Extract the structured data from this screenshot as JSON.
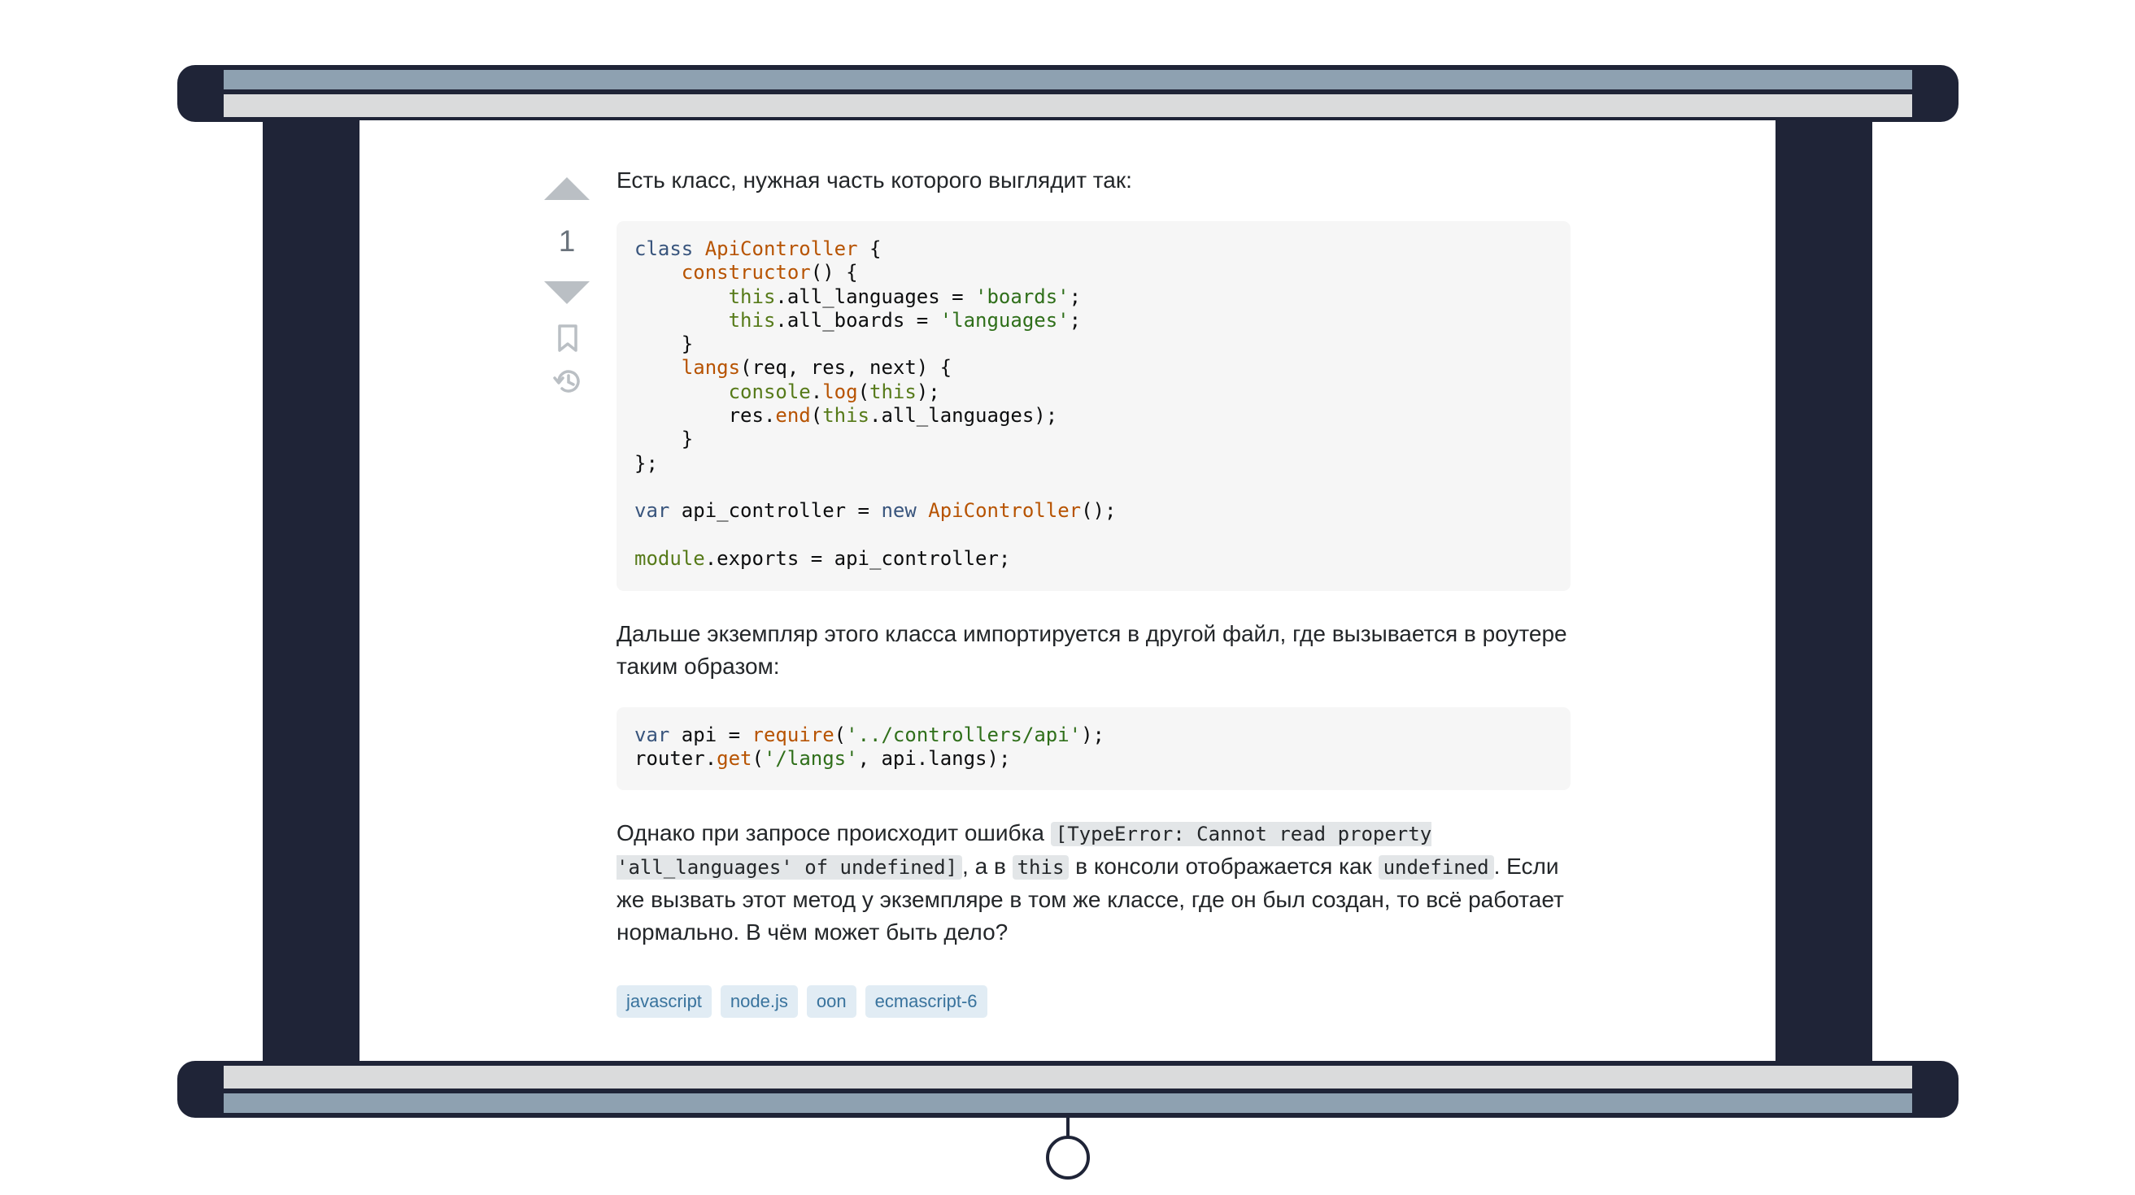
{
  "vote": {
    "count": "1",
    "upvote_icon": "triangle-up-icon",
    "downvote_icon": "triangle-down-icon",
    "bookmark_icon": "bookmark-icon",
    "history_icon": "history-icon"
  },
  "post": {
    "intro": "Есть класс, нужная часть которого выглядит так:",
    "middle": "Дальше экземпляр этого класса импортируется в другой файл, где вызывается в роутере таким образом:",
    "error_text_before": "Однако при запросе происходит ошибка ",
    "error_code": "[TypeError: Cannot read property 'all_languages' of undefined]",
    "error_text_mid1": ", а в ",
    "this_code": "this",
    "error_text_mid2": " в консоли отображается как ",
    "undefined_code": "undefined",
    "error_text_after": ". Если же вызвать этот метод у экземпляре в том же классе, где он был создан, то всё работает нормально. В чём может быть дело?"
  },
  "code_block_1": {
    "lines": [
      "class ApiController {",
      "    constructor() {",
      "        this.all_languages = 'boards';",
      "        this.all_boards = 'languages';",
      "    }",
      "    langs(req, res, next) {",
      "        console.log(this);",
      "        res.end(this.all_languages);",
      "    }",
      "};",
      "",
      "var api_controller = new ApiController();",
      "",
      "module.exports = api_controller;"
    ]
  },
  "code_block_2": {
    "lines": [
      "var api = require('../controllers/api');",
      "router.get('/langs', api.langs);"
    ]
  },
  "tags": [
    "javascript",
    "node.js",
    "oon",
    "ecmascript-6"
  ],
  "colors": {
    "frame": "#1f2437",
    "frame_blue": "#8ea1b1",
    "frame_gray": "#dadbdc",
    "tag_bg": "#e1ecf4",
    "tag_text": "#39739d",
    "code_bg": "#f6f6f6"
  }
}
